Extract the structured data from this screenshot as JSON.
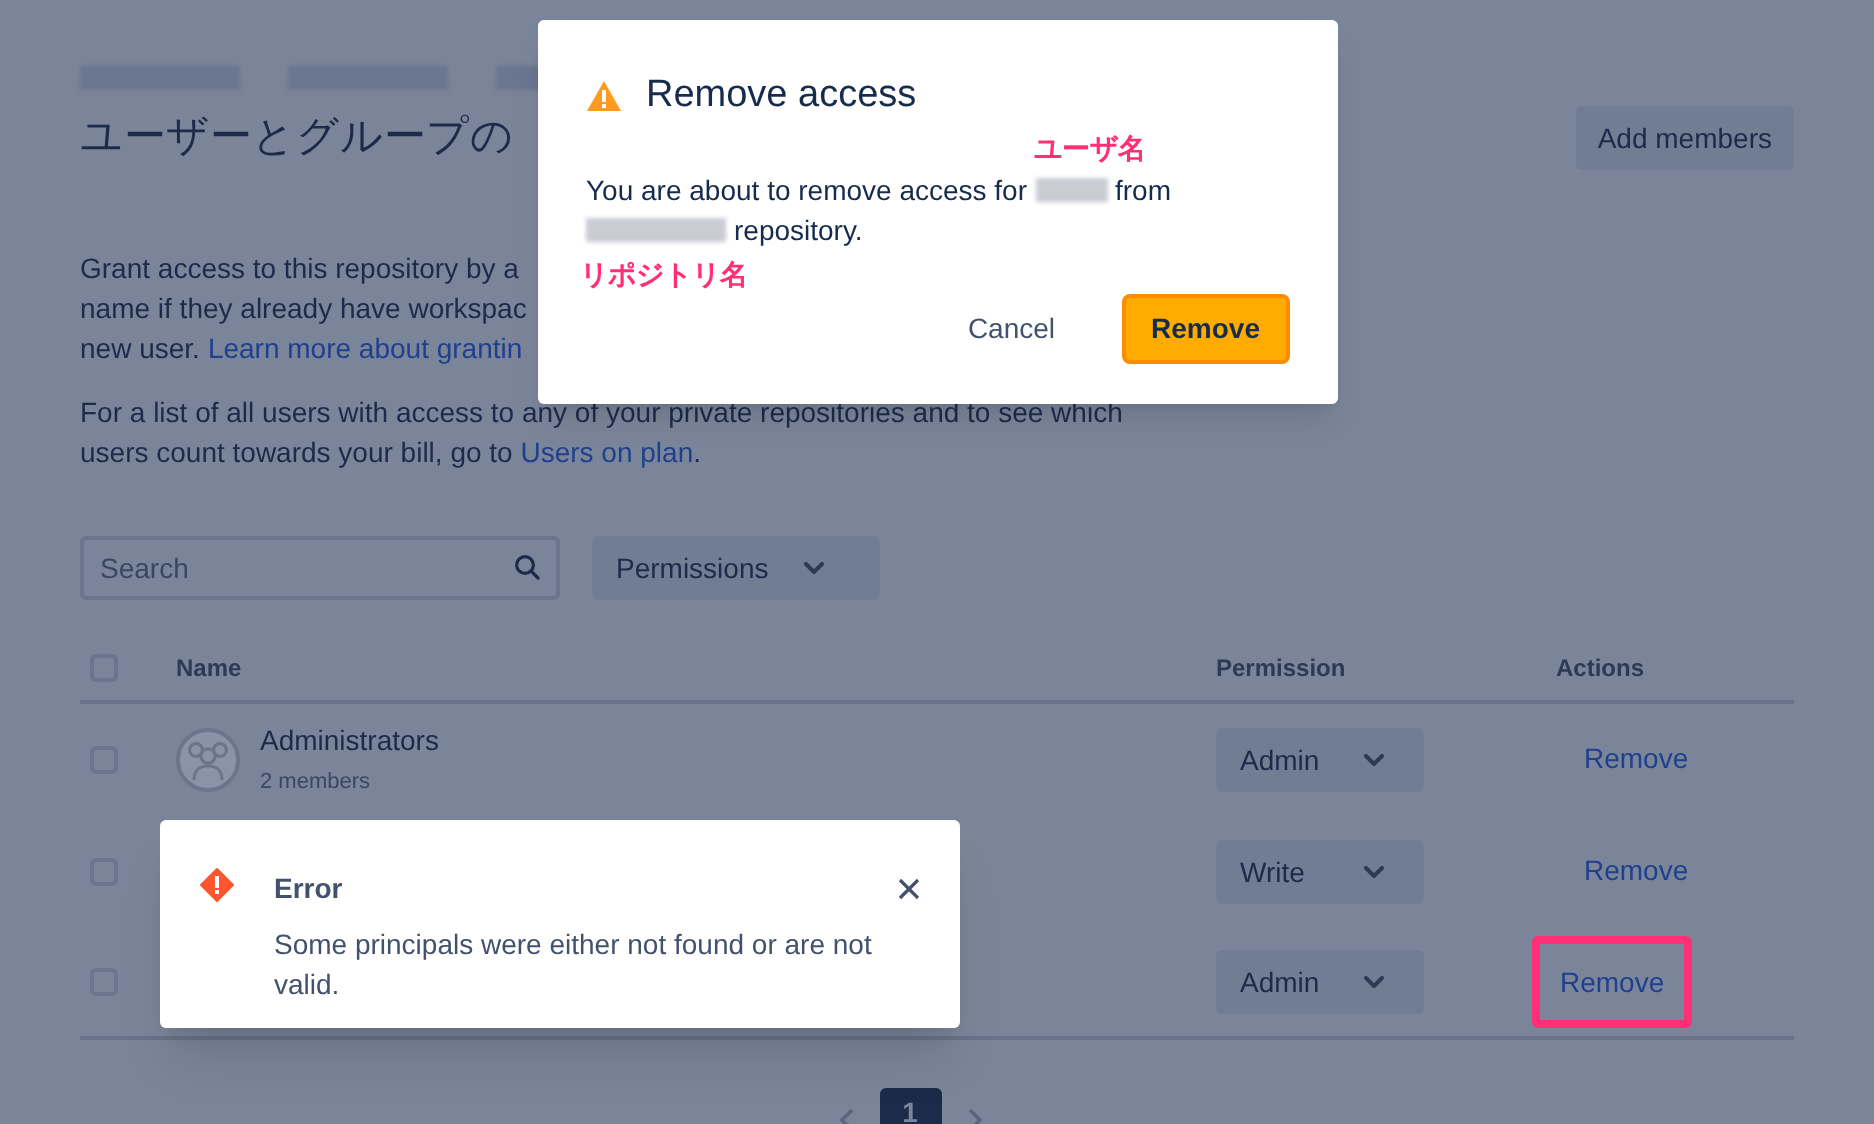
{
  "page": {
    "title": "ユーザーとグループの",
    "add_button": "Add members"
  },
  "intro": {
    "lines": [
      "Grant access to this repository by a",
      "name if they already have workspac"
    ],
    "last_line": "new user.",
    "link": "Learn more about grantin"
  },
  "plan": {
    "text": "For a list of all users with access to any of your private repositories and to see which users count towards your bill, go to",
    "link": "Users on plan",
    "end": "."
  },
  "toolbar": {
    "search": {
      "placeholder": "Search"
    },
    "filter": "Permissions"
  },
  "table": {
    "header_checked": false,
    "columns": [
      "Name",
      "Permission",
      "Actions"
    ],
    "rows": [
      {
        "checked": false,
        "name": "Administrators",
        "members": "2 members",
        "permission": "Admin",
        "action": "Remove",
        "highlighted": false
      },
      {
        "checked": false,
        "permission": "Write",
        "action": "Remove",
        "highlighted": false
      },
      {
        "checked": false,
        "permission": "Admin",
        "action": "Remove",
        "highlighted": true
      }
    ]
  },
  "pagination": {
    "pages": [
      {
        "label": "1",
        "selected": true
      }
    ]
  },
  "dialog": {
    "title": "Remove access",
    "message_start": "You are about to remove access for",
    "message_mid": "from",
    "message_end": "repository.",
    "buttons": [
      {
        "label": "Cancel",
        "kind": "subtle"
      },
      {
        "label": "Remove",
        "kind": "warning"
      }
    ]
  },
  "flag": {
    "title": "Error",
    "message": "Some principals were either not found or are not valid."
  },
  "annotations": [
    {
      "kind": "user",
      "text": "ユーザ名"
    },
    {
      "kind": "repo",
      "text": "リポジトリ名"
    }
  ]
}
